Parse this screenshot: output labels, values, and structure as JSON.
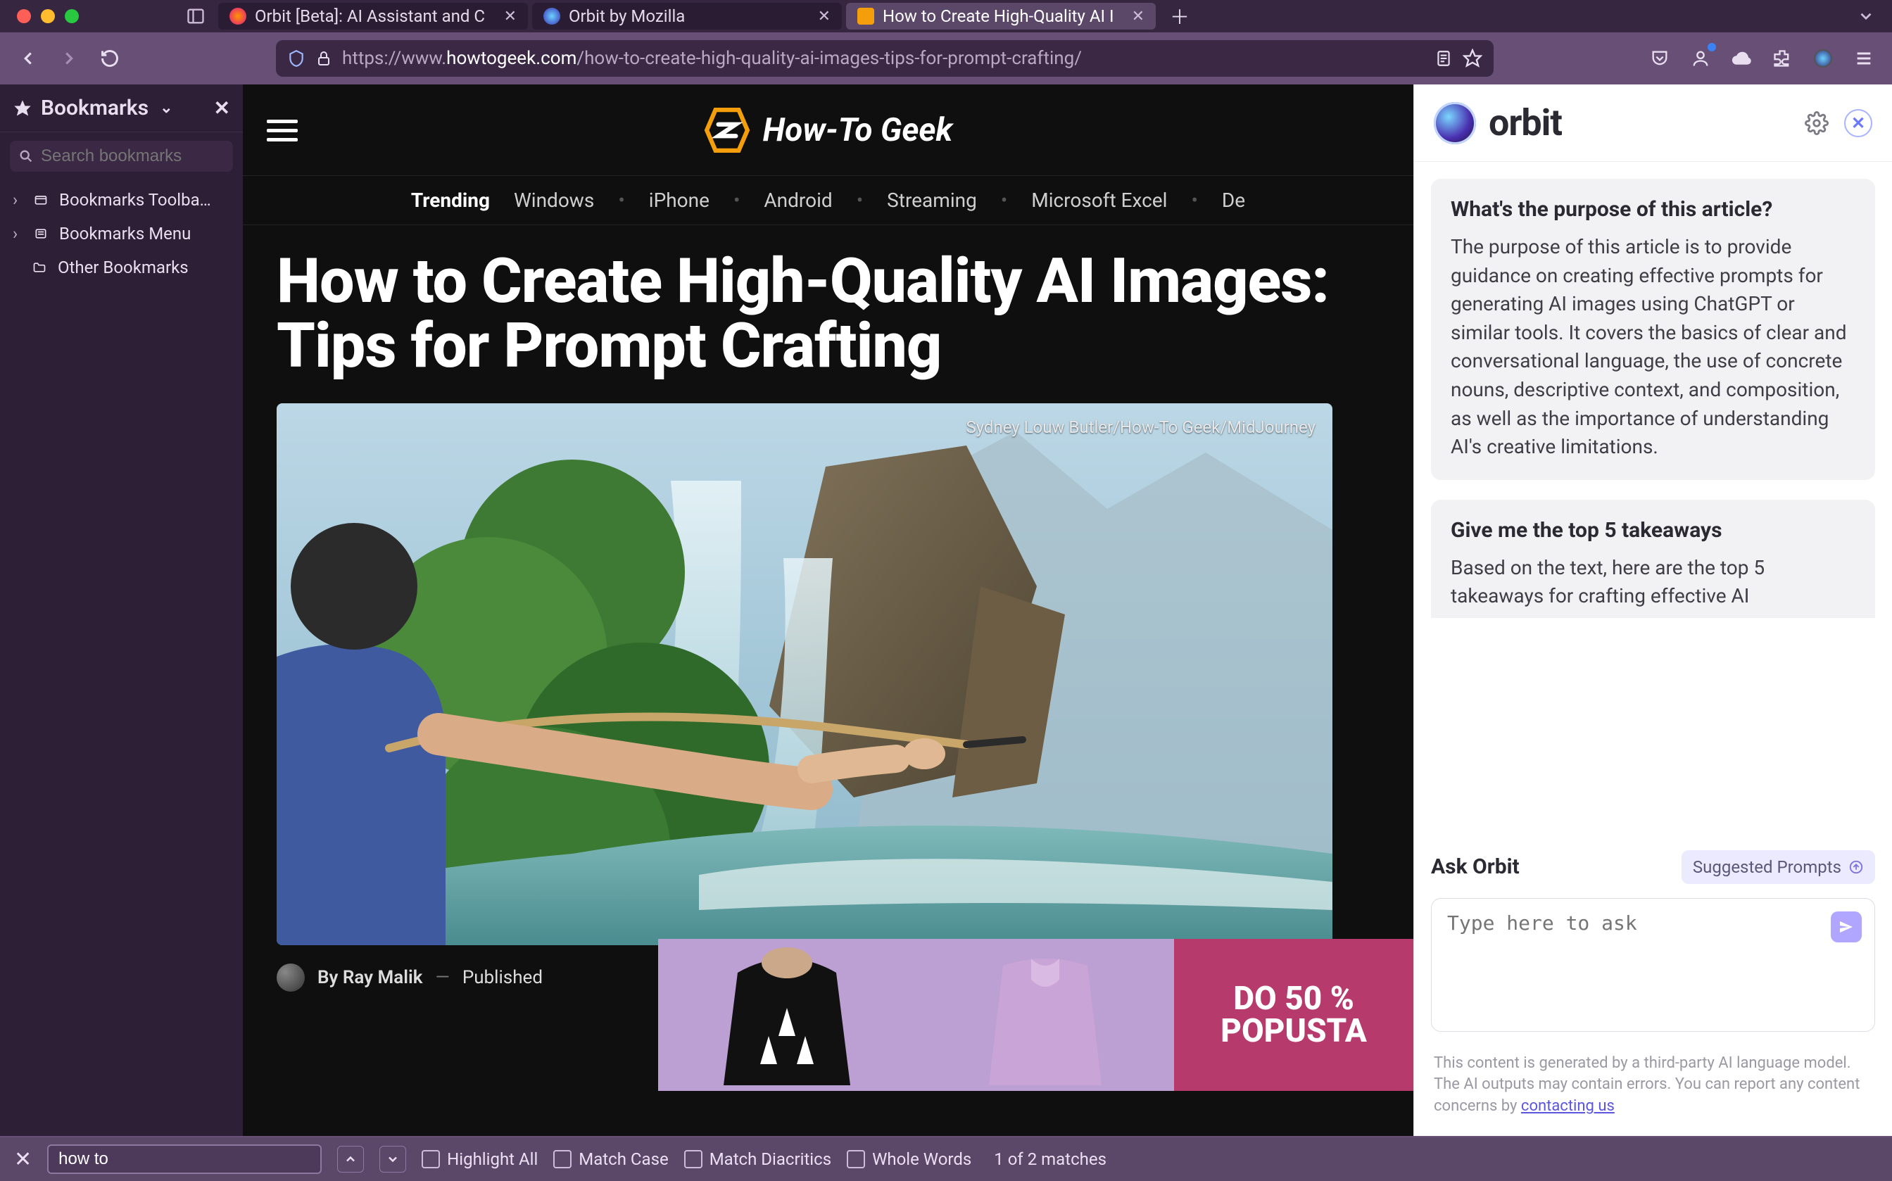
{
  "window": {
    "tabs": [
      {
        "label": "Orbit [Beta]: AI Assistant and C",
        "favicon": "firefox"
      },
      {
        "label": "Orbit by Mozilla",
        "favicon": "orbit"
      },
      {
        "label": "How to Create High-Quality AI I",
        "favicon": "htg"
      }
    ],
    "active_tab_index": 2
  },
  "toolbar": {
    "url_prefix": "https://www.",
    "url_host": "howtogeek.com",
    "url_path": "/how-to-create-high-quality-ai-images-tips-for-prompt-crafting/"
  },
  "bookmarks": {
    "title": "Bookmarks",
    "search_placeholder": "Search bookmarks",
    "items": [
      {
        "label": "Bookmarks Toolba…",
        "icon": "toolbar"
      },
      {
        "label": "Bookmarks Menu",
        "icon": "menu"
      },
      {
        "label": "Other Bookmarks",
        "icon": "folder"
      }
    ]
  },
  "page": {
    "site_name": "How-To Geek",
    "trending_label": "Trending",
    "trending_items": [
      "Windows",
      "iPhone",
      "Android",
      "Streaming",
      "Microsoft Excel",
      "De"
    ],
    "headline": "How to Create High-Quality AI Images: Tips for Prompt Crafting",
    "hero_credit": "Sydney Louw Butler/How-To Geek/MidJourney",
    "author": "By Ray Malik",
    "published_label": "Published",
    "ad_text_1": "DO 50 %",
    "ad_text_2": "POPUSTA"
  },
  "orbit": {
    "brand": "orbit",
    "cards": [
      {
        "q": "What's the purpose of this article?",
        "a": "The purpose of this article is to provide guidance on creating effective prompts for generating AI images using ChatGPT or similar tools. It covers the basics of clear and conversational language, the use of concrete nouns, descriptive context, and composition, as well as the importance of understanding AI's creative limitations."
      },
      {
        "q": "Give me the top 5 takeaways",
        "a": "Based on the text, here are the top 5 takeaways for crafting effective AI"
      }
    ],
    "ask_label": "Ask Orbit",
    "suggested_label": "Suggested Prompts",
    "ask_placeholder": "Type here to ask",
    "disclaimer": "This content is generated by a third-party AI language model. The AI outputs may contain errors. You can report any content concerns by ",
    "disclaimer_link": "contacting us"
  },
  "find": {
    "value": "how to",
    "opts": [
      "Highlight All",
      "Match Case",
      "Match Diacritics",
      "Whole Words"
    ],
    "status": "1 of 2 matches"
  }
}
